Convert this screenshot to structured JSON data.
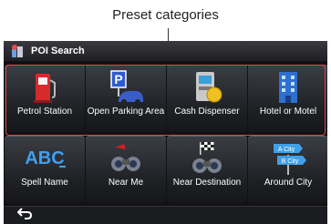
{
  "callout": {
    "text": "Preset categories"
  },
  "screen": {
    "title": "POI Search",
    "preset_tiles": [
      {
        "label": "Petrol Station",
        "icon": "petrol-pump-icon"
      },
      {
        "label": "Open Parking Area",
        "icon": "parking-icon"
      },
      {
        "label": "Cash Dispenser",
        "icon": "atm-icon"
      },
      {
        "label": "Hotel or Motel",
        "icon": "hotel-icon"
      }
    ],
    "search_tiles": [
      {
        "label": "Spell Name",
        "icon": "abc-icon"
      },
      {
        "label": "Near Me",
        "icon": "binoculars-icon"
      },
      {
        "label": "Near Destination",
        "icon": "binoculars-flag-icon"
      },
      {
        "label": "Around City",
        "icon": "city-sign-icon"
      }
    ],
    "back_icon": "back-arrow-icon"
  },
  "colors": {
    "highlight": "#e04545",
    "background": "#0b0b0d"
  }
}
